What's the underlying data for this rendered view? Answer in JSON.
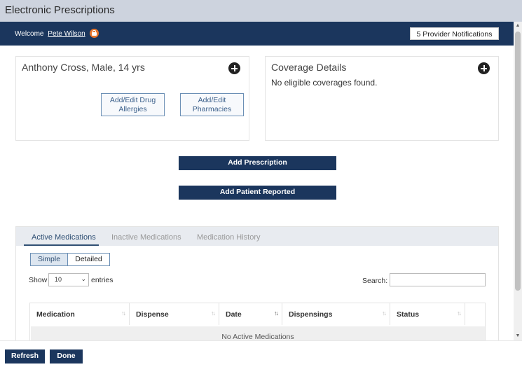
{
  "window": {
    "title": "Electronic Prescriptions"
  },
  "navbar": {
    "welcome_label": "Welcome",
    "user_name": "Pete Wilson",
    "notifications_label": "5 Provider Notifications"
  },
  "patient": {
    "summary": "Anthony Cross, Male, 14 yrs",
    "allergies_button": "Add/Edit Drug Allergies",
    "pharmacies_button": "Add/Edit Pharmacies"
  },
  "coverage": {
    "title": "Coverage Details",
    "message": "No eligible coverages found."
  },
  "actions": {
    "add_prescription": "Add Prescription",
    "add_patient_reported": "Add Patient Reported"
  },
  "medications": {
    "tabs": [
      {
        "label": "Active Medications",
        "active": true
      },
      {
        "label": "Inactive Medications",
        "active": false
      },
      {
        "label": "Medication History",
        "active": false
      }
    ],
    "view_toggle": {
      "simple": "Simple",
      "detailed": "Detailed",
      "selected": "Simple"
    },
    "show_label": "Show",
    "entries_value": "10",
    "entries_label": "entries",
    "search_label": "Search:",
    "search_value": "",
    "columns": [
      "Medication",
      "Dispense",
      "Date",
      "Dispensings",
      "Status"
    ],
    "sort_glyph": "↑↓",
    "empty_message": "No Active Medications"
  },
  "footer": {
    "refresh_label": "Refresh",
    "done_label": "Done"
  },
  "colors": {
    "navy": "#1b365d",
    "accent_orange": "#e8772e",
    "titlebar": "#cdd3de"
  }
}
